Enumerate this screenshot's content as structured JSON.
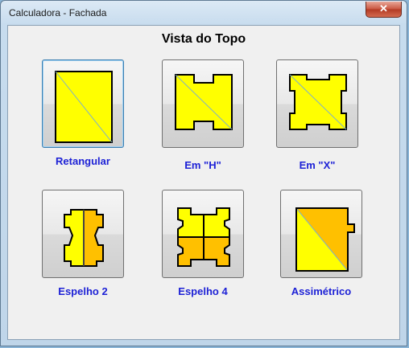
{
  "window": {
    "title": "Calculadora - Fachada",
    "close_glyph": "✕"
  },
  "heading": "Vista do Topo",
  "options": [
    {
      "label": "Retangular",
      "icon": "rectangular-shape-icon",
      "selected": true
    },
    {
      "label": "Em \"H\"",
      "icon": "h-shape-icon",
      "selected": false
    },
    {
      "label": "Em \"X\"",
      "icon": "x-shape-icon",
      "selected": false
    },
    {
      "label": "Espelho 2",
      "icon": "mirror-2-shape-icon",
      "selected": false
    },
    {
      "label": "Espelho 4",
      "icon": "mirror-4-shape-icon",
      "selected": false
    },
    {
      "label": "Assimétrico",
      "icon": "asymmetric-shape-icon",
      "selected": false
    }
  ],
  "colors": {
    "shape_fill": "#ffff00",
    "shape_fill_dark": "#ffc000",
    "label": "#1e22d6"
  }
}
